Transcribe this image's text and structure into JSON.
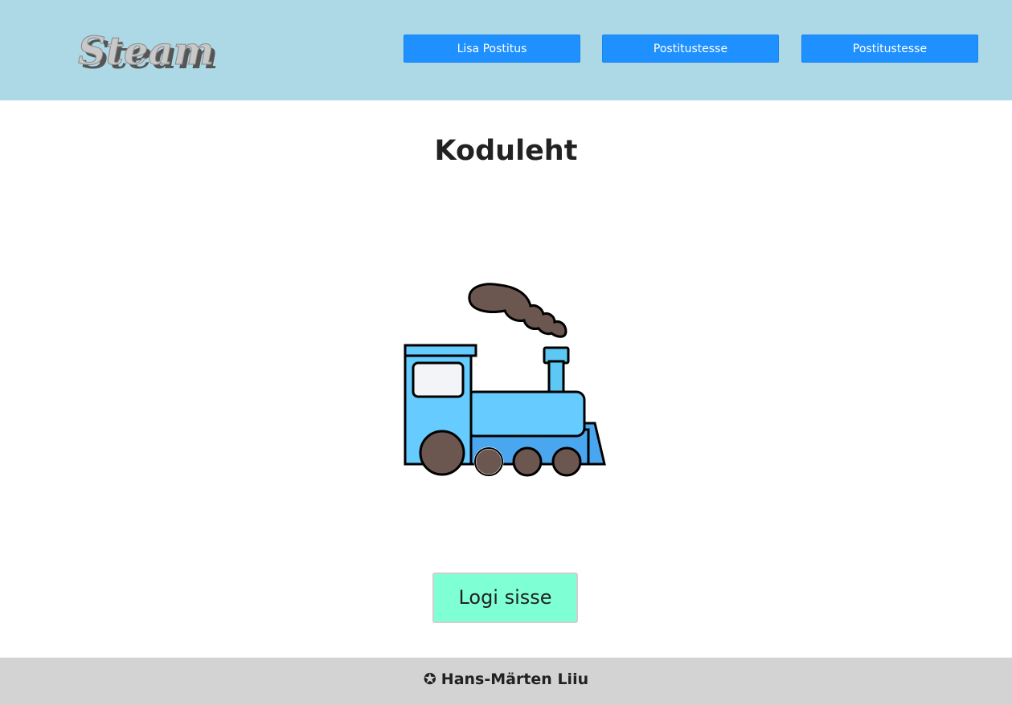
{
  "header": {
    "logo_text": "Steam",
    "nav": [
      {
        "label": "Lisa Postitus"
      },
      {
        "label": "Postitustesse"
      },
      {
        "label": "Postitustesse"
      }
    ]
  },
  "main": {
    "title": "Koduleht",
    "image_icon": "steam-train-icon",
    "login_label": "Logi sisse"
  },
  "footer": {
    "star_icon": "✪",
    "author": "Hans-Märten Liiu"
  },
  "colors": {
    "header_bg": "#add8e6",
    "nav_button": "#1e90ff",
    "login_button": "#7fffd4",
    "footer_bg": "#d3d3d3"
  }
}
